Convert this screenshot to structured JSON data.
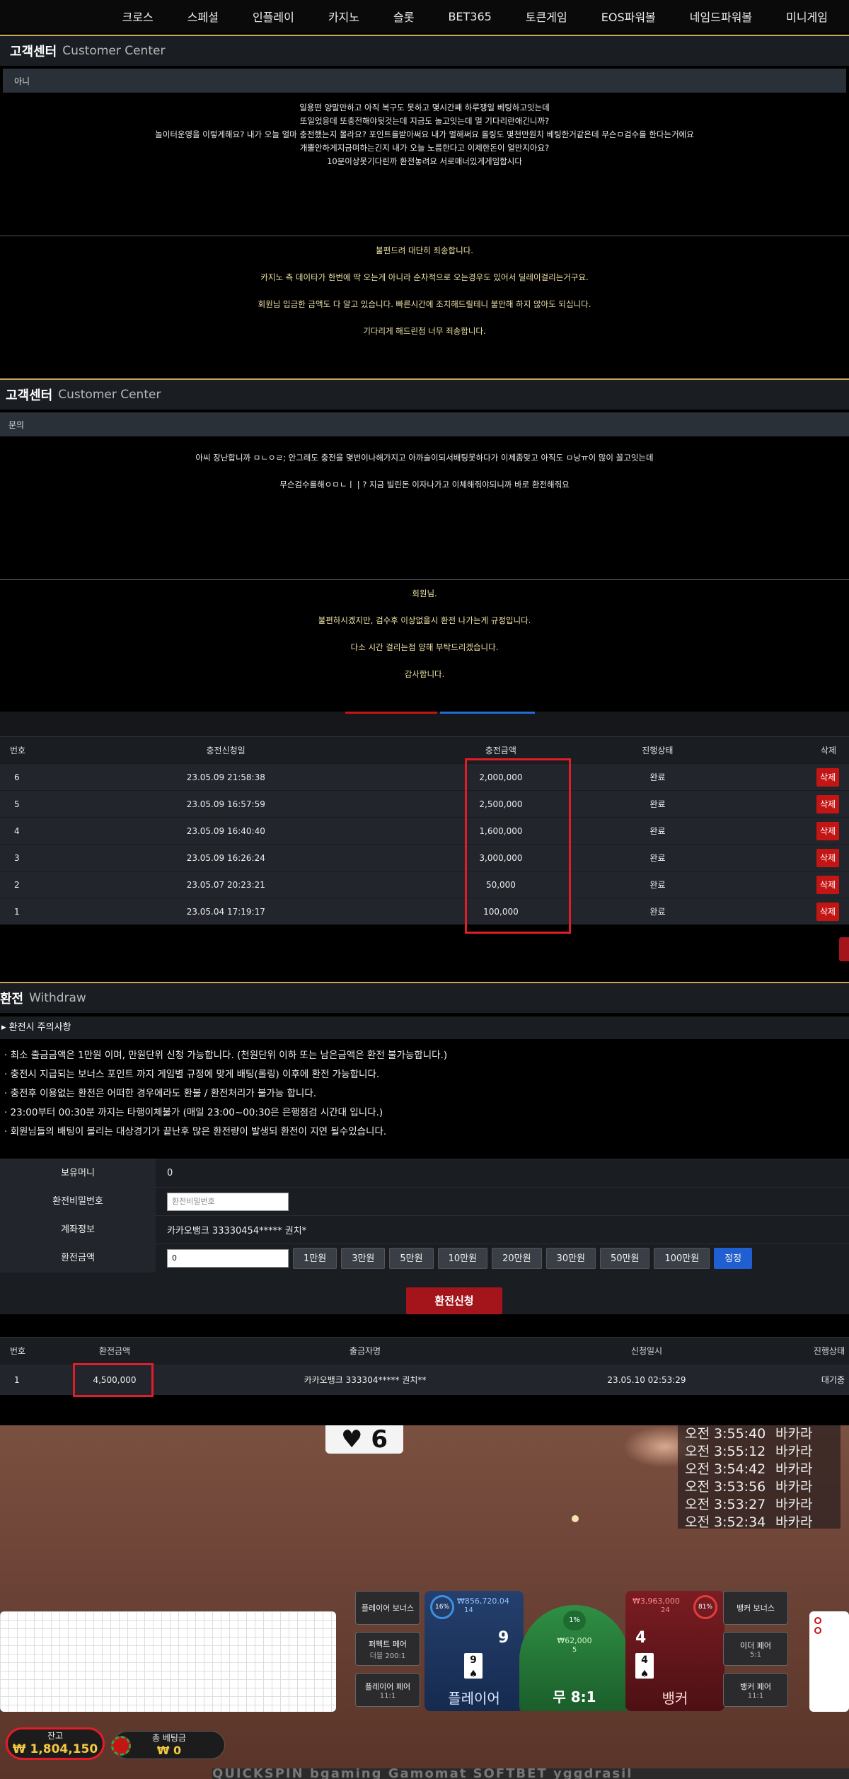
{
  "nav": [
    "크로스",
    "스페셜",
    "인플레이",
    "카지노",
    "슬롯",
    "BET365",
    "토큰게임",
    "EOS파워볼",
    "네임드파워볼",
    "미니게임"
  ],
  "cs1": {
    "title": "고객센터",
    "subtitle": "Customer Center",
    "subject": "아니",
    "lines": [
      "일용떤 양말만하고 아직 복구도 못하고 몇시간째 하루쟁일 베팅하고잇는데",
      "또일었응데 또충전해야뒷것는데 지금도 놀고잇는데 멀 기다리란애긴니까?",
      "놀이터운영을 이렇게해요? 내가 오늘 얼마 충전했는지 몰라요? 포인트를받아써요 내가 멀해써요 롤링도 몇천만원치 베팅한거같은데 무슨ㅁ검수를 한다는거에요",
      "개뿔안하게지금며하는긴지 내가 오늘 노름한다고 이제한돈이 얼만지아요?",
      "10분이상못기다린까 환전놓려요 서로매너있게게임합시다"
    ],
    "answers": [
      "불편드려 대단히 죄송합니다.",
      "카지노 측 데이타가 한번에 딱 오는게 아니라 순차적으로 오는경우도 있어서 딜레이걸리는거구요.",
      "회원님 입금한 금액도 다 알고 있습니다. 빠른시간에 조치해드릴테니 불만해 하지 않아도 되십니다.",
      "기다리게 해드린점 너무 죄송합니다."
    ]
  },
  "cs2": {
    "title": "고객센터",
    "subtitle": "Customer Center",
    "subject": "문의",
    "lines": [
      "아씨 장난합니까 ㅁㄴㅇㄹ; 안그래도 충전을 몇번이나해가지고 아까술이되서배팅못하다가 이제좀맞고 아직도 ㅁ낭ㅠ이 많이 꼴고잇는데",
      "무슨검수를해ㅇㅁㄴㅣ | ? 지금 빌린돈 이자나가고 이체해줘야되니까 바로 환전해줘요"
    ],
    "answers": [
      "회원님.",
      "불편하시겠지만, 검수후 이상없을시 환전 나가는게 규정입니다.",
      "다소 시간 걸리는점 양해 부탁드리겠습니다.",
      "감사합니다."
    ]
  },
  "deposit": {
    "headers": [
      "번호",
      "충전신청일",
      "충전금액",
      "진행상태",
      "삭제"
    ],
    "delete_label": "삭제",
    "rows": [
      [
        "6",
        "23.05.09 21:58:38",
        "2,000,000",
        "완료"
      ],
      [
        "5",
        "23.05.09 16:57:59",
        "2,500,000",
        "완료"
      ],
      [
        "4",
        "23.05.09 16:40:40",
        "1,600,000",
        "완료"
      ],
      [
        "3",
        "23.05.09 16:26:24",
        "3,000,000",
        "완료"
      ],
      [
        "2",
        "23.05.07 20:23:21",
        "50,000",
        "완료"
      ],
      [
        "1",
        "23.05.04 17:19:17",
        "100,000",
        "완료"
      ]
    ]
  },
  "withdraw": {
    "title": "환전",
    "subtitle": "Withdraw",
    "notice_title": "▸ 환전시 주의사항",
    "notices": [
      "· 최소 출금금액은 1만원 이며, 만원단위 신청 가능합니다. (천원단위 이하 또는 남은금액은 환전 불가능합니다.)",
      "· 충전시 지급되는 보너스 포인트 까지 게임별 규정에 맞게 배팅(롤링) 이후에 환전 가능합니다.",
      "· 충전후 이용없는 환전은 어떠한 경우에라도 환불 / 환전처리가 불가능 합니다.",
      "· 23:00부터 00:30분 까지는 타행이체불가 (매일 23:00~00:30은 은행점검 시간대 입니다.)",
      "· 회원님들의 배팅이 몰리는 대상경기가 끝난후 많은 환전량이 발생되 환전이 지연 될수있습니다."
    ],
    "money_label": "보유머니",
    "money_value": "0",
    "pw_label": "환전비밀번호",
    "pw_placeholder": "환전비밀번호",
    "account_label": "계좌정보",
    "account_value": "카카오뱅크 33330454***** 권치*",
    "amount_label": "환전금액",
    "amount_value": "0",
    "amount_buttons": [
      "1만원",
      "3만원",
      "5만원",
      "10만원",
      "20만원",
      "30만원",
      "50만원",
      "100만원"
    ],
    "correct_label": "정정",
    "submit_label": "환전신청"
  },
  "withdraw_list": {
    "headers": [
      "번호",
      "환전금액",
      "출금자명",
      "신청일시",
      "진행상태"
    ],
    "rows": [
      [
        "1",
        "4,500,000",
        "카카오뱅크 333304***** 권치**",
        "23.05.10 02:53:29",
        "대기중"
      ]
    ]
  },
  "casino": {
    "card": "♥ 6",
    "history": [
      [
        "오전 3:55:40",
        "바카라"
      ],
      [
        "오전 3:55:12",
        "바카라"
      ],
      [
        "오전 3:54:42",
        "바카라"
      ],
      [
        "오전 3:53:56",
        "바카라"
      ],
      [
        "오전 3:53:27",
        "바카라"
      ],
      [
        "오전 3:52:34",
        "바카라"
      ]
    ],
    "player_bonus": "플레이어 보너스",
    "perfect_pair": "퍼펙트 페어",
    "perfect_pair_odds": "더블 200:1",
    "player_pair": "플레이어 페어",
    "player_pair_odds": "11:1",
    "player_pct": "16%",
    "player_amount": "₩856,720.04",
    "player_count": "14",
    "player_score": "9",
    "player_label": "플레이어",
    "tie_pct": "1%",
    "tie_amount": "₩62,000",
    "tie_count": "5",
    "tie_label": "무 8:1",
    "banker_pct": "81%",
    "banker_amount": "₩3,963,000",
    "banker_count": "24",
    "banker_score": "4",
    "banker_label": "뱅커",
    "banker_bonus": "뱅커 보너스",
    "either_pair": "이더 페어",
    "either_pair_odds": "5:1",
    "banker_pair": "뱅커 페어",
    "banker_pair_odds": "11:1",
    "balance_label": "잔고",
    "balance_value": "₩ 1,804,150",
    "total_bet_label": "총 베팅금",
    "total_bet_value": "₩ 0",
    "brands": "QUICKSPIN   bgaming   Gamomat   SOFTBET   yggdrasil"
  }
}
